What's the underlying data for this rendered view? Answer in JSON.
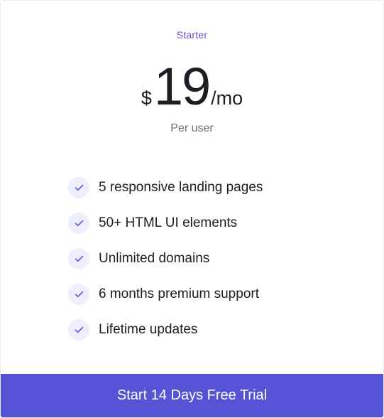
{
  "plan": {
    "name": "Starter",
    "currency": "$",
    "amount": "19",
    "period": "/mo",
    "billing_note": "Per user"
  },
  "features": [
    {
      "label": "5 responsive landing pages",
      "icon": "check-icon"
    },
    {
      "label": "50+ HTML UI elements",
      "icon": "check-icon"
    },
    {
      "label": "Unlimited domains",
      "icon": "check-icon"
    },
    {
      "label": "6 months premium support",
      "icon": "check-icon"
    },
    {
      "label": "Lifetime updates",
      "icon": "check-icon"
    }
  ],
  "cta": {
    "label": "Start 14 Days Free Trial"
  },
  "colors": {
    "accent": "#5753d6",
    "check_bg": "#eeeefc",
    "text": "#1d1d24",
    "muted": "#6e6e7a"
  }
}
